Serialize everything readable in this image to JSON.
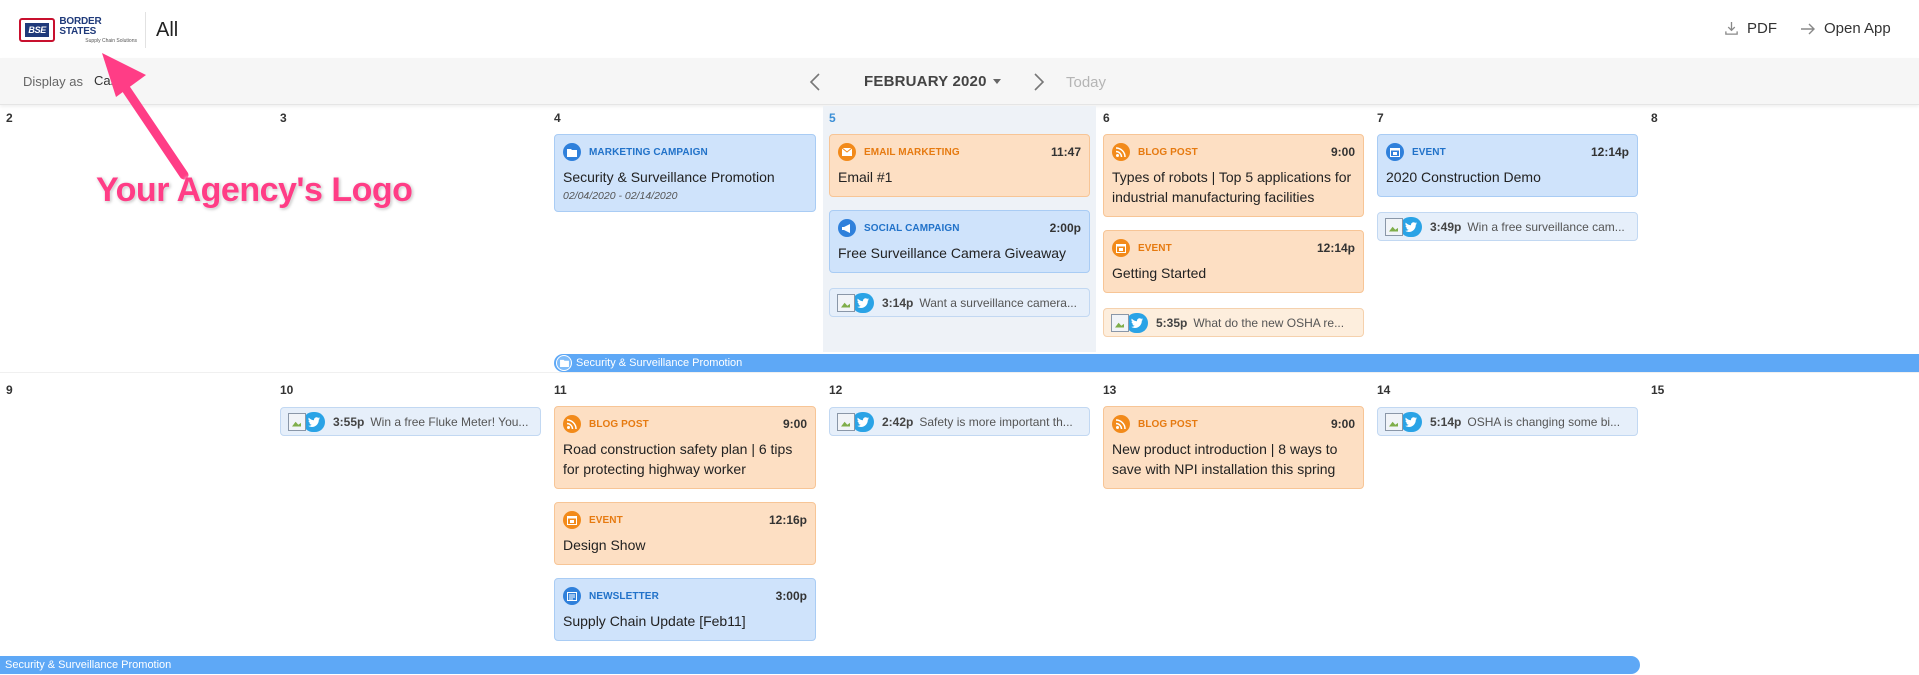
{
  "header": {
    "logo_badge": "BSE",
    "logo_name": "BORDER STATES",
    "logo_tag": "Supply Chain Solutions",
    "filter_title": "All",
    "pdf_label": "PDF",
    "open_app_label": "Open App"
  },
  "toolbar": {
    "display_as_label": "Display as",
    "display_as_value": "Cal",
    "month_label": "FEBRUARY 2020",
    "today_label": "Today"
  },
  "annotation": {
    "text": "Your Agency's Logo",
    "color": "#ff3d86"
  },
  "week1": {
    "days": [
      "2",
      "3",
      "4",
      "5",
      "6",
      "7",
      "8"
    ],
    "today_index": 3,
    "cards": [
      {
        "type": "MARKETING CAMPAIGN",
        "time": "",
        "title": "Security & Surveillance Promotion",
        "sub": "02/04/2020 - 02/14/2020",
        "color": "blue",
        "icon": "folder-icon"
      },
      {
        "type": "EMAIL MARKETING",
        "time": "11:47",
        "title": "Email #1",
        "color": "orange",
        "icon": "envelope-icon"
      },
      {
        "type": "SOCIAL CAMPAIGN",
        "time": "2:00p",
        "title": "Free Surveillance Camera Giveaway",
        "color": "blue",
        "icon": "megaphone-icon"
      },
      {
        "type": "BLOG POST",
        "time": "9:00",
        "title": "Types of robots | Top 5 applications for industrial manufacturing facilities",
        "color": "orange",
        "icon": "rss-icon"
      },
      {
        "type": "EVENT",
        "time": "12:14p",
        "title": "Getting Started",
        "color": "orange",
        "icon": "calendar-icon"
      },
      {
        "type": "EVENT",
        "time": "12:14p",
        "title": "2020 Construction Demo",
        "color": "blue",
        "icon": "calendar-icon"
      }
    ],
    "social": [
      {
        "time": "3:14p",
        "text": "Want a surveillance camera..."
      },
      {
        "time": "5:35p",
        "text": "What do the new OSHA re..."
      },
      {
        "time": "3:49p",
        "text": "Win a free surveillance cam..."
      }
    ],
    "span_bar": "Security & Surveillance Promotion"
  },
  "week2": {
    "days": [
      "9",
      "10",
      "11",
      "12",
      "13",
      "14",
      "15"
    ],
    "cards": [
      {
        "type": "BLOG POST",
        "time": "9:00",
        "title": "Road construction safety plan | 6 tips for protecting highway worker",
        "color": "orange",
        "icon": "rss-icon"
      },
      {
        "type": "EVENT",
        "time": "12:16p",
        "title": "Design Show",
        "color": "orange",
        "icon": "calendar-icon"
      },
      {
        "type": "NEWSLETTER",
        "time": "3:00p",
        "title": "Supply Chain Update [Feb11]",
        "color": "blue",
        "icon": "newspaper-icon"
      },
      {
        "type": "BLOG POST",
        "time": "9:00",
        "title": "New product introduction | 8 ways to save with NPI installation this spring",
        "color": "orange",
        "icon": "rss-icon"
      }
    ],
    "social": [
      {
        "time": "3:55p",
        "text": "Win a free Fluke Meter! You..."
      },
      {
        "time": "2:42p",
        "text": "Safety is more important th..."
      },
      {
        "time": "5:14p",
        "text": "OSHA is changing some bi..."
      }
    ],
    "span_bar": "Security & Surveillance Promotion"
  },
  "colors": {
    "card_blue": "#cfe3fb",
    "card_orange": "#fddfc3",
    "span_bar": "#5ea8f6",
    "today_num": "#3b8fd6"
  }
}
